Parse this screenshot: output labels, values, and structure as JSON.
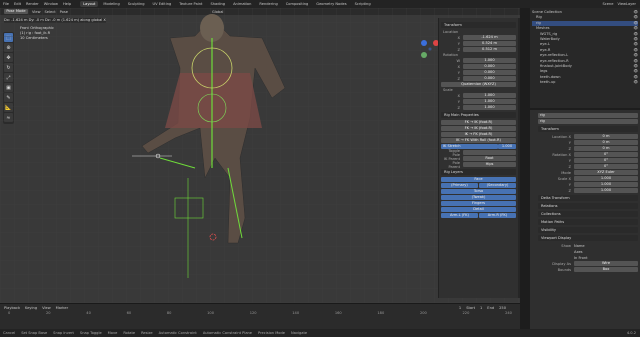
{
  "topbar": {
    "menus": [
      "File",
      "Edit",
      "Render",
      "Window",
      "Help"
    ],
    "workspaces": [
      "Layout",
      "Modeling",
      "Sculpting",
      "UV Editing",
      "Texture Paint",
      "Shading",
      "Animation",
      "Rendering",
      "Compositing",
      "Geometry Nodes",
      "Scripting"
    ],
    "scene": "Scene",
    "view_layer": "ViewLayer"
  },
  "viewport": {
    "mode": "Pose Mode",
    "menus": [
      "View",
      "Select",
      "Pose"
    ],
    "orientation": "Global",
    "info": [
      "Dx: -1.624 m  Dy: -0 m  Dz: -0 m (1.624 m) along global X",
      "Front Orthographic",
      "(1) rig : foot_ik.R",
      "10 Centimeters"
    ]
  },
  "transform": {
    "title": "Transform",
    "location_label": "Location",
    "loc": [
      "-1.624 m",
      "0.524 m",
      "0.512 m"
    ],
    "rotation_label": "Rotation",
    "rot_w": "1.000",
    "rot": [
      "0.000",
      "0.000",
      "0.000"
    ],
    "rot_mode": "Quaternion (WXYZ)",
    "scale_label": "Scale",
    "scale": [
      "1.000",
      "1.000",
      "1.000"
    ]
  },
  "rig_main": {
    "title": "Rig Main Properties",
    "buttons": [
      "FK → IK (foot.R)",
      "FK → IK (foot.R)",
      "IK → FK (foot.R)",
      "IK → FK With Roll (foot.R)"
    ],
    "ik_stretch": "IK Stretch",
    "ik_stretch_val": "1.000",
    "toggle_pole": "Toggle Pole",
    "ik_parent": "IK Parent",
    "ik_parent_val": "Root",
    "pole_parent": "Pole Parent",
    "pole_parent_val": "Hips"
  },
  "rig_layers": {
    "title": "Rig Layers",
    "buttons": [
      "Face",
      "(Primary)",
      "(Secondary)",
      "Torso",
      "(Tweak)",
      "Fingers",
      "Detail",
      "Arm.L (FK)",
      "Arm.R (FK)"
    ]
  },
  "outliner": {
    "items": [
      "Scene Collection",
      "Rig",
      "rig",
      "Meshes",
      "WGTS_rig",
      "WaterBody",
      "eye-L",
      "eye-R",
      "eye-reflection-L",
      "eye-reflection-R",
      "finalout-jointBody",
      "legs",
      "teeth-down",
      "teeth-up"
    ]
  },
  "props": {
    "object": "rig",
    "name": "rig",
    "transform": "Transform",
    "loc_label": "Location X",
    "loc": [
      "0 m",
      "0 m",
      "0 m"
    ],
    "rot_label": "Rotation X",
    "rot": [
      "0°",
      "0°",
      "0°"
    ],
    "mode_label": "Mode",
    "mode": "XYZ Euler",
    "scale_label": "Scale X",
    "scale": [
      "1.000",
      "1.000",
      "1.000"
    ],
    "sections": [
      "Delta Transform",
      "Relations",
      "Collections",
      "Motion Paths",
      "Visibility",
      "Viewport Display"
    ],
    "show": "Show",
    "show_items": [
      "Name",
      "Axes",
      "In Front"
    ],
    "display_as_label": "Display As",
    "display_as": "Wire",
    "bounds": "Bounds",
    "bounds_val": "Box"
  },
  "timeline": {
    "menus": [
      "Playback",
      "Keying",
      "View",
      "Marker"
    ],
    "frame": "1",
    "start": "1",
    "end": "250",
    "start_label": "Start",
    "end_label": "End",
    "ticks": [
      "0",
      "20",
      "40",
      "60",
      "80",
      "100",
      "120",
      "140",
      "160",
      "180",
      "200",
      "220",
      "240"
    ]
  },
  "status": {
    "items": [
      "Cancel",
      "Set Snap Base",
      "Snap Invert",
      "Snap Toggle",
      "Move",
      "Rotate",
      "Resize",
      "Automatic Constraint",
      "Automatic Constraint Plane",
      "Precision Mode",
      "Navigate"
    ],
    "version": "4.0.2"
  }
}
